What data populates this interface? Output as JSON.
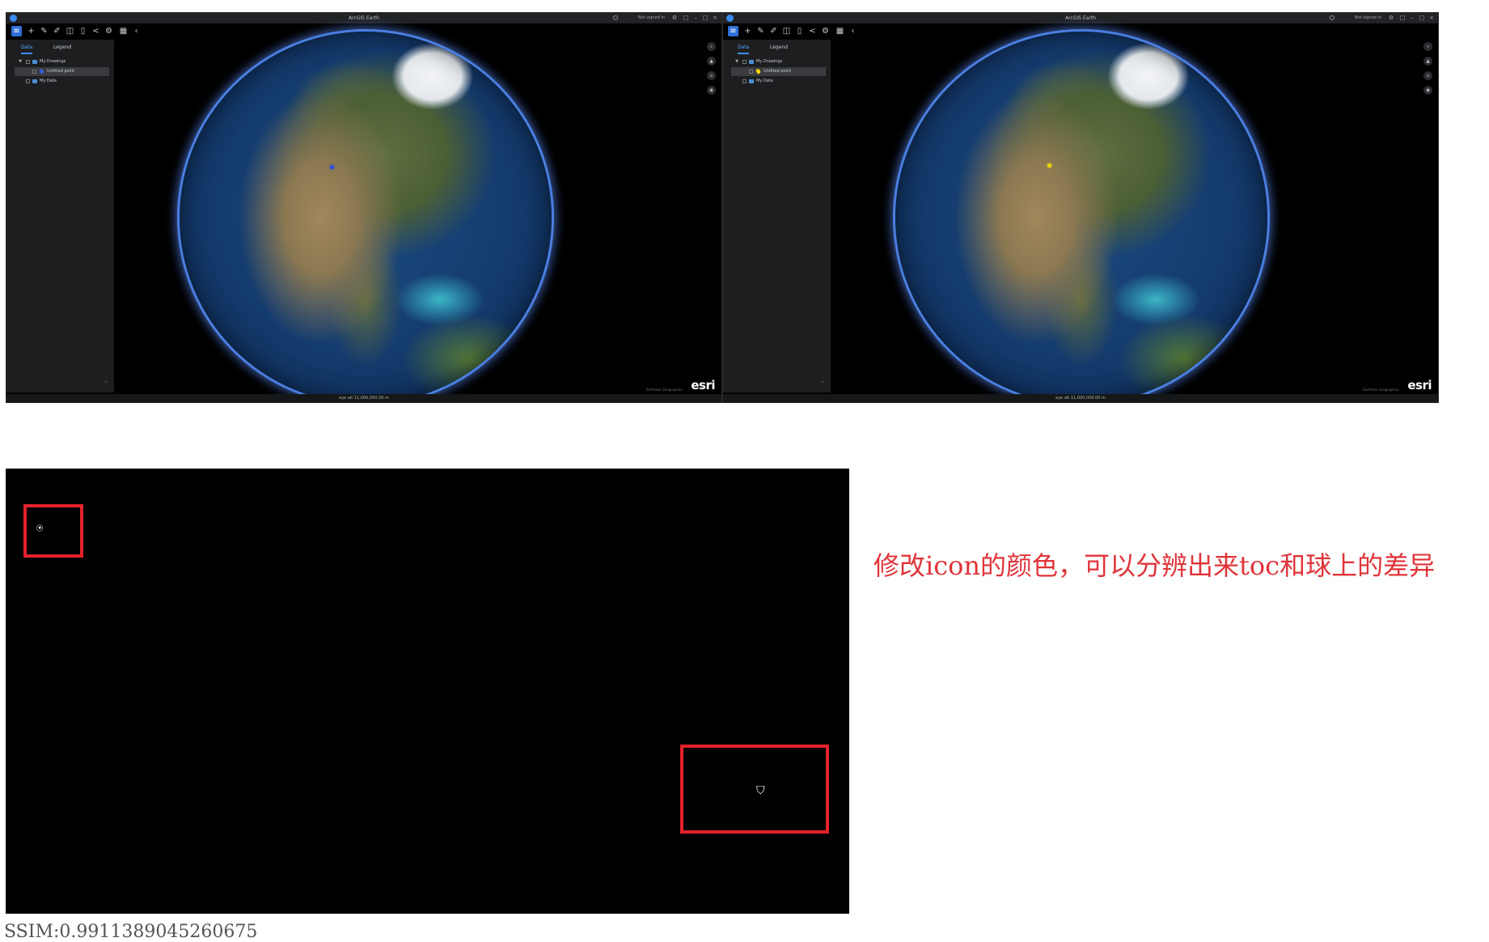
{
  "windows": [
    {
      "title": "ArcGIS Earth",
      "signin": "Not signed in",
      "tabs": [
        "Data",
        "Legend"
      ],
      "toc": {
        "group": "My Drawings",
        "item": "Untitled point",
        "data": "My Data"
      },
      "status": "eye alt 11,000,000.00 m",
      "credits": "Earthstar Geographics",
      "logo": "esri",
      "toc_icon_color": "#3a5bd9",
      "globe_marker_color": "#2b4fe0"
    },
    {
      "title": "ArcGIS Earth",
      "signin": "Not signed in",
      "tabs": [
        "Data",
        "Legend"
      ],
      "toc": {
        "group": "My Drawings",
        "item": "Untitled point",
        "data": "My Data"
      },
      "status": "eye alt 11,000,000.00 m",
      "credits": "Earthstar Geographics",
      "logo": "esri",
      "toc_icon_color": "#f2d400",
      "globe_marker_color": "#f2d400"
    }
  ],
  "note": "修改icon的颜色，可以分辨出来toc和球上的差异",
  "ssim": "SSIM:0.9911389045260675",
  "highlight_color": "#e3222c"
}
